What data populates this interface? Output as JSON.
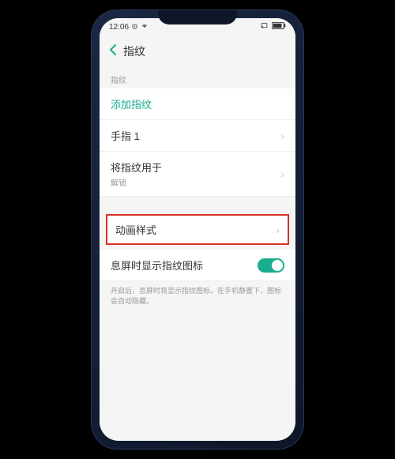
{
  "status": {
    "time": "12:06",
    "alarm_icon": "alarm-icon",
    "wifi_icon": "wifi-icon",
    "cast_icon": "cast-icon",
    "battery_icon": "battery-icon"
  },
  "header": {
    "back_icon": "chevron-left-icon",
    "title": "指纹"
  },
  "section": {
    "label": "指纹"
  },
  "items": {
    "add": {
      "label": "添加指纹"
    },
    "finger1": {
      "label": "手指 1"
    },
    "usedFor": {
      "label": "将指纹用于",
      "sub": "解锁"
    },
    "animation": {
      "label": "动画样式"
    },
    "aod": {
      "label": "息屏时显示指纹图标"
    }
  },
  "help": "开启后，息屏时将显示指纹图标。在手机静置下，图标会自动隐藏。"
}
